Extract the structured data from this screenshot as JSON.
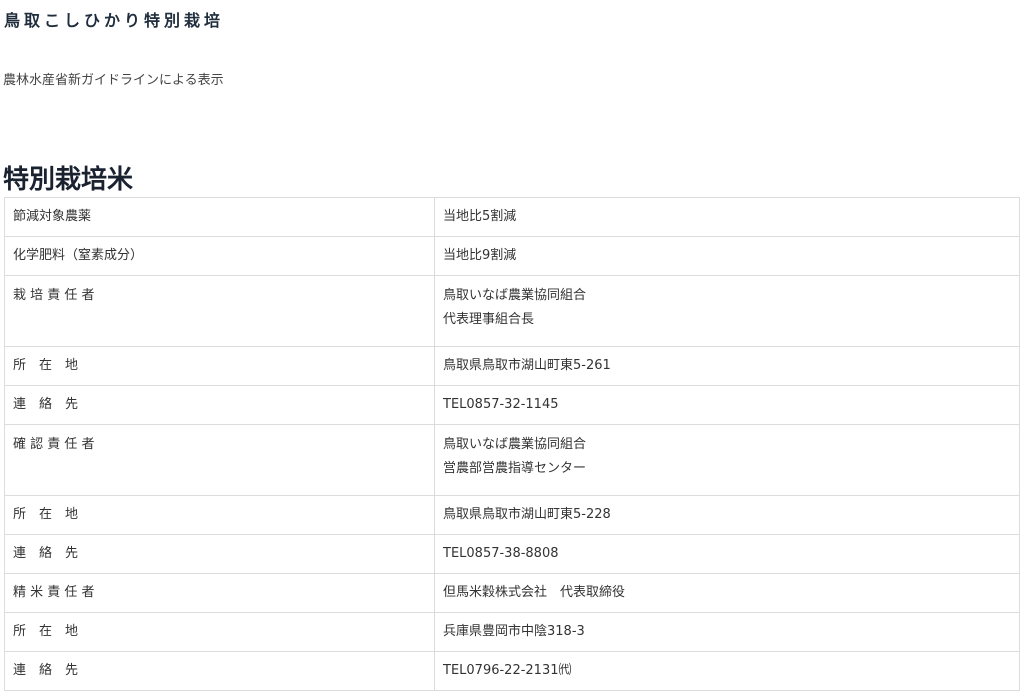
{
  "header": {
    "title": "鳥取こしひかり特別栽培",
    "subtitle": "農林水産省新ガイドラインによる表示"
  },
  "section": {
    "title": "特別栽培米"
  },
  "table": {
    "rows": [
      {
        "label": "節減対象農薬",
        "values": [
          "当地比5割減"
        ]
      },
      {
        "label": "化学肥料（窒素成分）",
        "values": [
          "当地比9割減"
        ]
      },
      {
        "label": "栽 培 責 任 者",
        "values": [
          "鳥取いなば農業協同組合",
          "代表理事組合長"
        ]
      },
      {
        "label": "所　在　地",
        "values": [
          "鳥取県鳥取市湖山町東5-261"
        ]
      },
      {
        "label": "連　絡　先",
        "values": [
          "TEL0857-32-1145"
        ]
      },
      {
        "label": "確 認 責 任 者",
        "values": [
          "鳥取いなば農業協同組合",
          "営農部営農指導センター"
        ]
      },
      {
        "label": "所　在　地",
        "values": [
          "鳥取県鳥取市湖山町東5-228"
        ]
      },
      {
        "label": "連　絡　先",
        "values": [
          "TEL0857-38-8808"
        ]
      },
      {
        "label": "精 米 責 任 者",
        "values": [
          "但馬米穀株式会社　代表取締役"
        ]
      },
      {
        "label": "所　在　地",
        "values": [
          "兵庫県豊岡市中陰318-3"
        ]
      },
      {
        "label": "連　絡　先",
        "values": [
          "TEL0796-22-2131㈹"
        ]
      }
    ]
  }
}
